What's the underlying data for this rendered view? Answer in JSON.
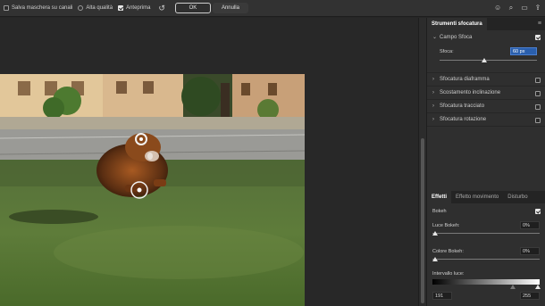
{
  "options_bar": {
    "save_mask": "Salva maschera su canali",
    "high_quality": "Alta qualità",
    "preview": "Anteprima",
    "ok": "OK",
    "cancel": "Annulla",
    "undo_icon": "reset-icon",
    "icons": [
      "user-icon",
      "search-icon",
      "workspace-icon",
      "share-icon"
    ]
  },
  "blur_tools": {
    "tab": "Strumenti sfocatura",
    "field_blur": {
      "label": "Campo Sfoca",
      "blur_label": "Sfoca:",
      "blur_value": "60 px",
      "enabled": true
    },
    "items": [
      {
        "label": "Sfocatura diaframma"
      },
      {
        "label": "Scostamento inclinazione"
      },
      {
        "label": "Sfocatura tracciato"
      },
      {
        "label": "Sfocatura rotazione"
      }
    ]
  },
  "effects": {
    "tabs": [
      "Effetti",
      "Effetto movimento",
      "Disturbo"
    ],
    "bokeh_label": "Bokeh",
    "bokeh_enabled": true,
    "light_bokeh_label": "Luce Bokeh:",
    "light_bokeh_value": "0%",
    "color_bokeh_label": "Colore Bokeh:",
    "color_bokeh_value": "0%",
    "light_range_label": "Intervallo luce:",
    "light_range_low": "191",
    "light_range_high": "255"
  },
  "colors": {
    "accent": "#2a5fad",
    "panel": "#2f2f2f",
    "canvas": "#282828"
  }
}
